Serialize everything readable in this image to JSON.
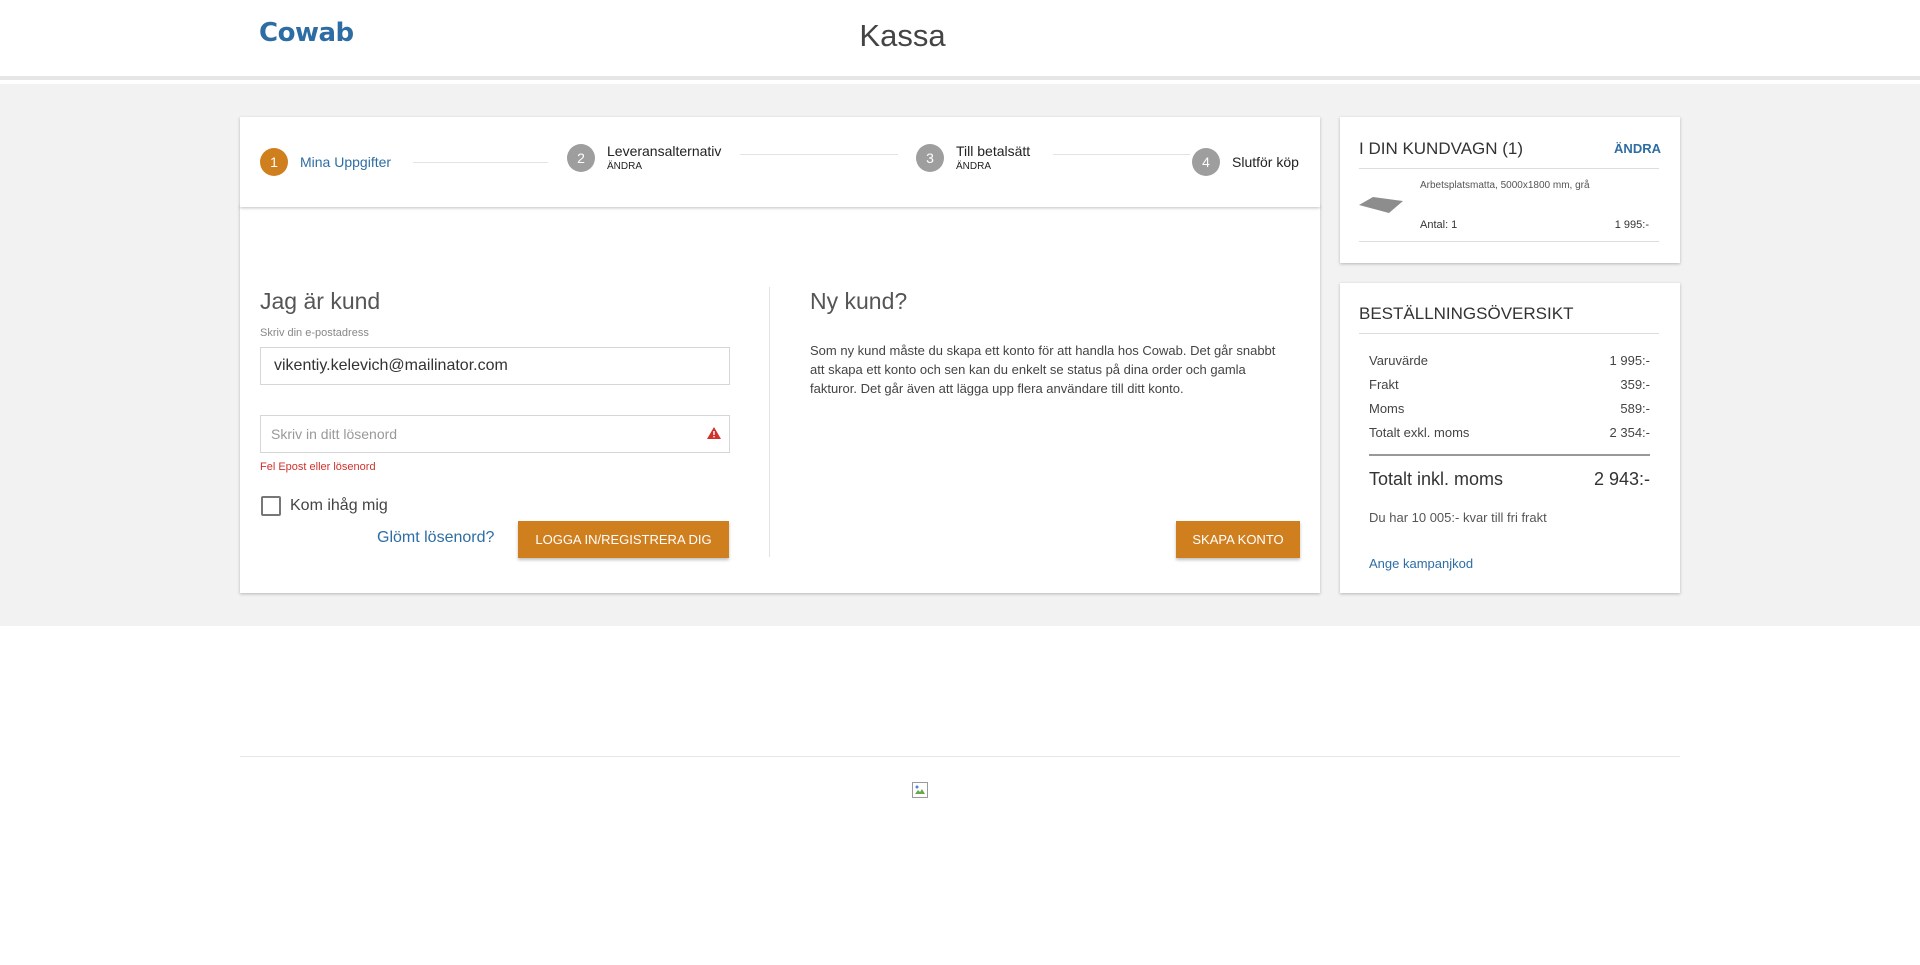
{
  "header": {
    "logo": "Cowab",
    "title": "Kassa"
  },
  "steps": [
    {
      "num": "1",
      "label": "Mina Uppgifter",
      "sub": ""
    },
    {
      "num": "2",
      "label": "Leveransalternativ",
      "sub": "ÄNDRA"
    },
    {
      "num": "3",
      "label": "Till betalsätt",
      "sub": "ÄNDRA"
    },
    {
      "num": "4",
      "label": "Slutför köp",
      "sub": ""
    }
  ],
  "login": {
    "title": "Jag är kund",
    "email_label": "Skriv din e-postadress",
    "email_value": "vikentiy.kelevich@mailinator.com",
    "password_placeholder": "Skriv in ditt lösenord",
    "error": "Fel Epost eller lösenord",
    "remember": "Kom ihåg mig",
    "forgot": "Glömt lösenord?",
    "login_button": "LOGGA IN/REGISTRERA DIG"
  },
  "new_customer": {
    "title": "Ny kund?",
    "text": "Som ny kund måste du skapa ett konto för att handla hos Cowab. Det går snabbt att skapa ett konto och sen kan du enkelt se status på dina order och gamla fakturor. Det går även att lägga upp flera användare till ditt konto.",
    "create_button": "SKAPA KONTO"
  },
  "cart": {
    "title": "I DIN KUNDVAGN (1)",
    "change": "ÄNDRA",
    "item_name": "Arbetsplatsmatta, 5000x1800 mm, grå",
    "item_qty": "Antal: 1",
    "item_price": "1 995:-"
  },
  "summary": {
    "title": "BESTÄLLNINGSÖVERSIKT",
    "rows": [
      {
        "label": "Varuvärde",
        "value": "1 995:-"
      },
      {
        "label": "Frakt",
        "value": "359:-"
      },
      {
        "label": "Moms",
        "value": "589:-"
      },
      {
        "label": "Totalt exkl. moms",
        "value": "2 354:-"
      }
    ],
    "total_label": "Totalt inkl. moms",
    "total_value": "2 943:-",
    "free_shipping": "Du har 10 005:- kvar till fri frakt",
    "campaign": "Ange kampanjkod"
  },
  "colors": {
    "accent": "#d07f1e",
    "link": "#2e6da4",
    "error": "#d0312d"
  },
  "icons": {
    "warning": "warning-triangle-icon",
    "footer_image": "broken-image-icon"
  }
}
